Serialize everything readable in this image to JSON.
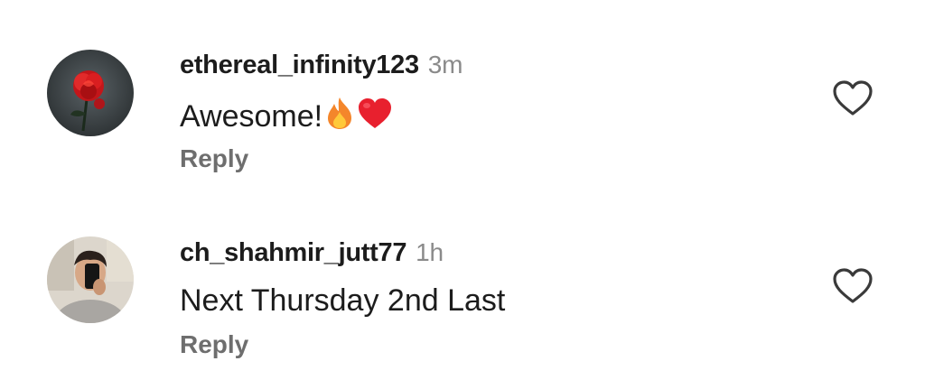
{
  "comments": [
    {
      "username": "ethereal_infinity123",
      "time": "3m",
      "text": "Awesome!",
      "emojis": [
        "fire-emoji",
        "red-heart-emoji"
      ],
      "reply_label": "Reply",
      "avatar": "red-rose-avatar",
      "like_icon": "heart-outline-icon"
    },
    {
      "username": "ch_shahmir_jutt77",
      "time": "1h",
      "text": "Next Thursday 2nd Last",
      "reply_label": "Reply",
      "avatar": "selfie-person-avatar",
      "like_icon": "heart-outline-icon"
    }
  ],
  "colors": {
    "text_primary": "#1c1c1c",
    "text_secondary": "#8a8a8a",
    "reply": "#6e6e6e",
    "background": "#ffffff"
  }
}
